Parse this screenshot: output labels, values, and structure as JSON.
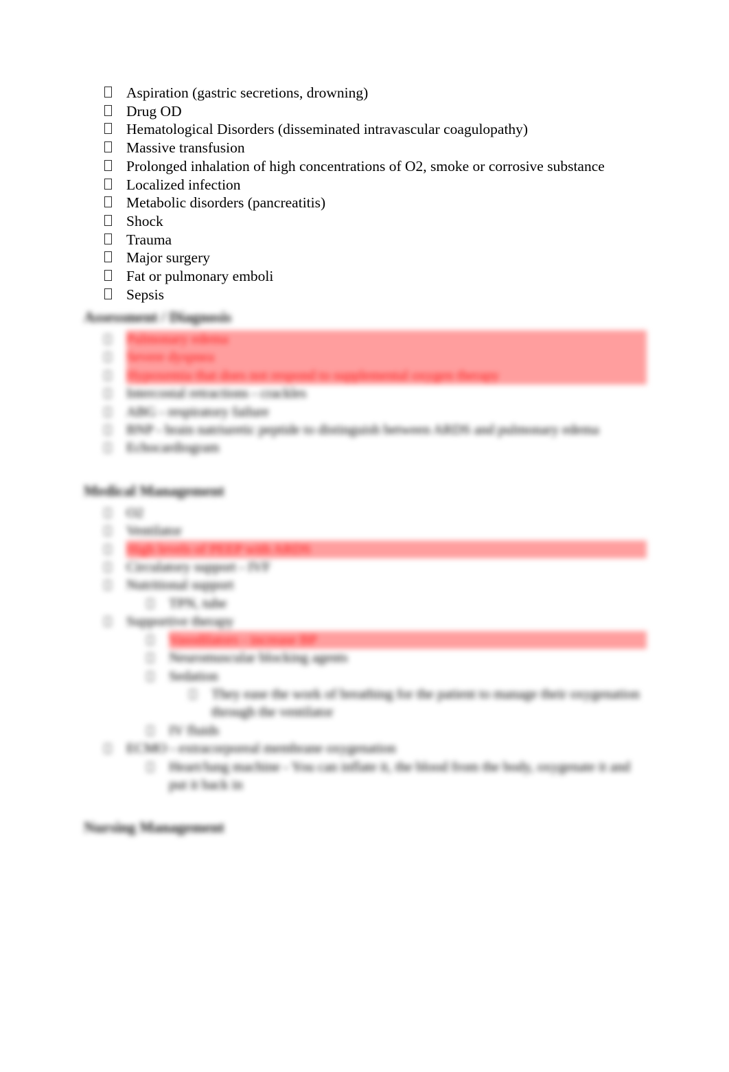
{
  "document": {
    "bullet_glyph": "tofu-box",
    "accent_color": "#ff1010",
    "highlight_color": "#ff9e9e",
    "text_color": "#000000"
  },
  "causes_list": [
    "Aspiration (gastric secretions, drowning)",
    "Drug OD",
    "Hematological Disorders (disseminated intravascular coagulopathy)",
    "Massive transfusion",
    "Prolonged inhalation of high concentrations of O2, smoke or corrosive substance",
    "Localized infection",
    "Metabolic disorders (pancreatitis)",
    "Shock",
    "Trauma",
    "Major surgery",
    "Fat or pulmonary emboli",
    "Sepsis"
  ],
  "sections": [
    {
      "heading": "Assessment / Diagnosis",
      "items": [
        {
          "indent": 1,
          "text": "Pulmonary edema",
          "highlight": true
        },
        {
          "indent": 1,
          "text": "Severe dyspnea",
          "highlight": true
        },
        {
          "indent": 1,
          "text": "Hypoxemia that does not respond to supplemental oxygen therapy",
          "highlight": true
        },
        {
          "indent": 1,
          "text": "Intercostal retractions - crackles",
          "highlight": false
        },
        {
          "indent": 1,
          "text": "ABG - respiratory failure",
          "highlight": false
        },
        {
          "indent": 1,
          "text": "BNP - brain natriuretic peptide to distinguish between ARDS and pulmonary edema",
          "highlight": false
        },
        {
          "indent": 1,
          "text": "Echocardiogram",
          "highlight": false
        }
      ]
    },
    {
      "heading": "Medical Management",
      "items": [
        {
          "indent": 1,
          "text": "O2",
          "highlight": false
        },
        {
          "indent": 1,
          "text": "Ventilator",
          "highlight": false
        },
        {
          "indent": 1,
          "text": "High levels of PEEP with ARDS",
          "highlight": true
        },
        {
          "indent": 1,
          "text": "Circulatory support - IVF",
          "highlight": false
        },
        {
          "indent": 1,
          "text": "Nutritional support",
          "highlight": false
        },
        {
          "indent": 2,
          "text": "TPN, tube",
          "highlight": false
        },
        {
          "indent": 1,
          "text": "Supportive therapy",
          "highlight": false
        },
        {
          "indent": 2,
          "text": "Vasodilators - increase BP",
          "highlight": true
        },
        {
          "indent": 2,
          "text": "Neuromuscular blocking agents",
          "highlight": false
        },
        {
          "indent": 2,
          "text": "Sedation",
          "highlight": false
        },
        {
          "indent": 3,
          "text": "They ease the work of breathing for the patient to manage their oxygenation through the ventilator",
          "highlight": false
        },
        {
          "indent": 2,
          "text": "IV fluids",
          "highlight": false
        },
        {
          "indent": 1,
          "text": "ECMO - extracorporeal membrane oxygenation",
          "highlight": true,
          "highlight_word_only": true
        },
        {
          "indent": 2,
          "text": "Heart/lung machine - You can inflate it, the blood from the body, oxygenate it and put it back in",
          "highlight": false
        }
      ]
    },
    {
      "heading": "Nursing Management",
      "items": []
    }
  ]
}
